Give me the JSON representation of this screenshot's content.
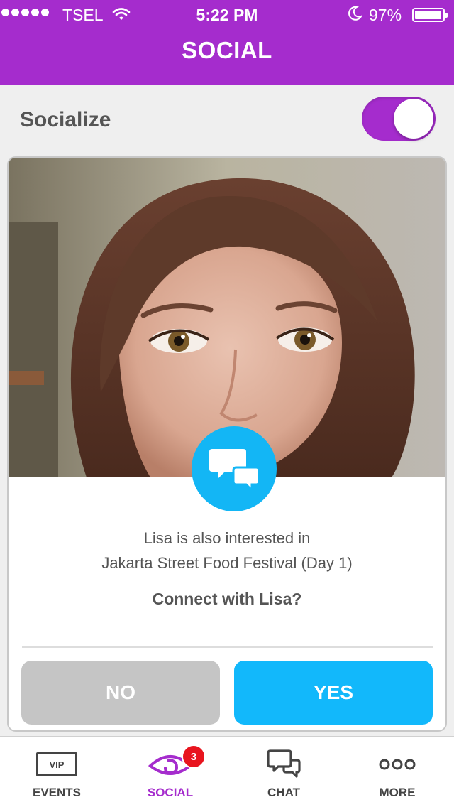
{
  "status_bar": {
    "carrier": "TSEL",
    "time": "5:22 PM",
    "battery_percent": "97%",
    "battery_level": 0.97
  },
  "nav": {
    "title": "SOCIAL"
  },
  "socialize": {
    "label": "Socialize",
    "enabled": true
  },
  "card": {
    "photo_subject": "Lisa",
    "info_line1": "Lisa is also interested in",
    "info_line2": "Jakarta Street Food Festival (Day 1)",
    "connect_prompt": "Connect with Lisa?",
    "no_label": "NO",
    "yes_label": "YES"
  },
  "tabs": [
    {
      "label": "EVENTS",
      "icon": "vip-icon",
      "vip_text": "VIP"
    },
    {
      "label": "SOCIAL",
      "icon": "eye-icon",
      "badge": "3",
      "active": true
    },
    {
      "label": "CHAT",
      "icon": "chat-bubbles-icon"
    },
    {
      "label": "MORE",
      "icon": "more-dots-icon"
    }
  ],
  "colors": {
    "brand_purple": "#a52ccd",
    "accent_blue": "#12b8fb",
    "no_gray": "#c5c5c5",
    "badge_red": "#e8141e"
  }
}
